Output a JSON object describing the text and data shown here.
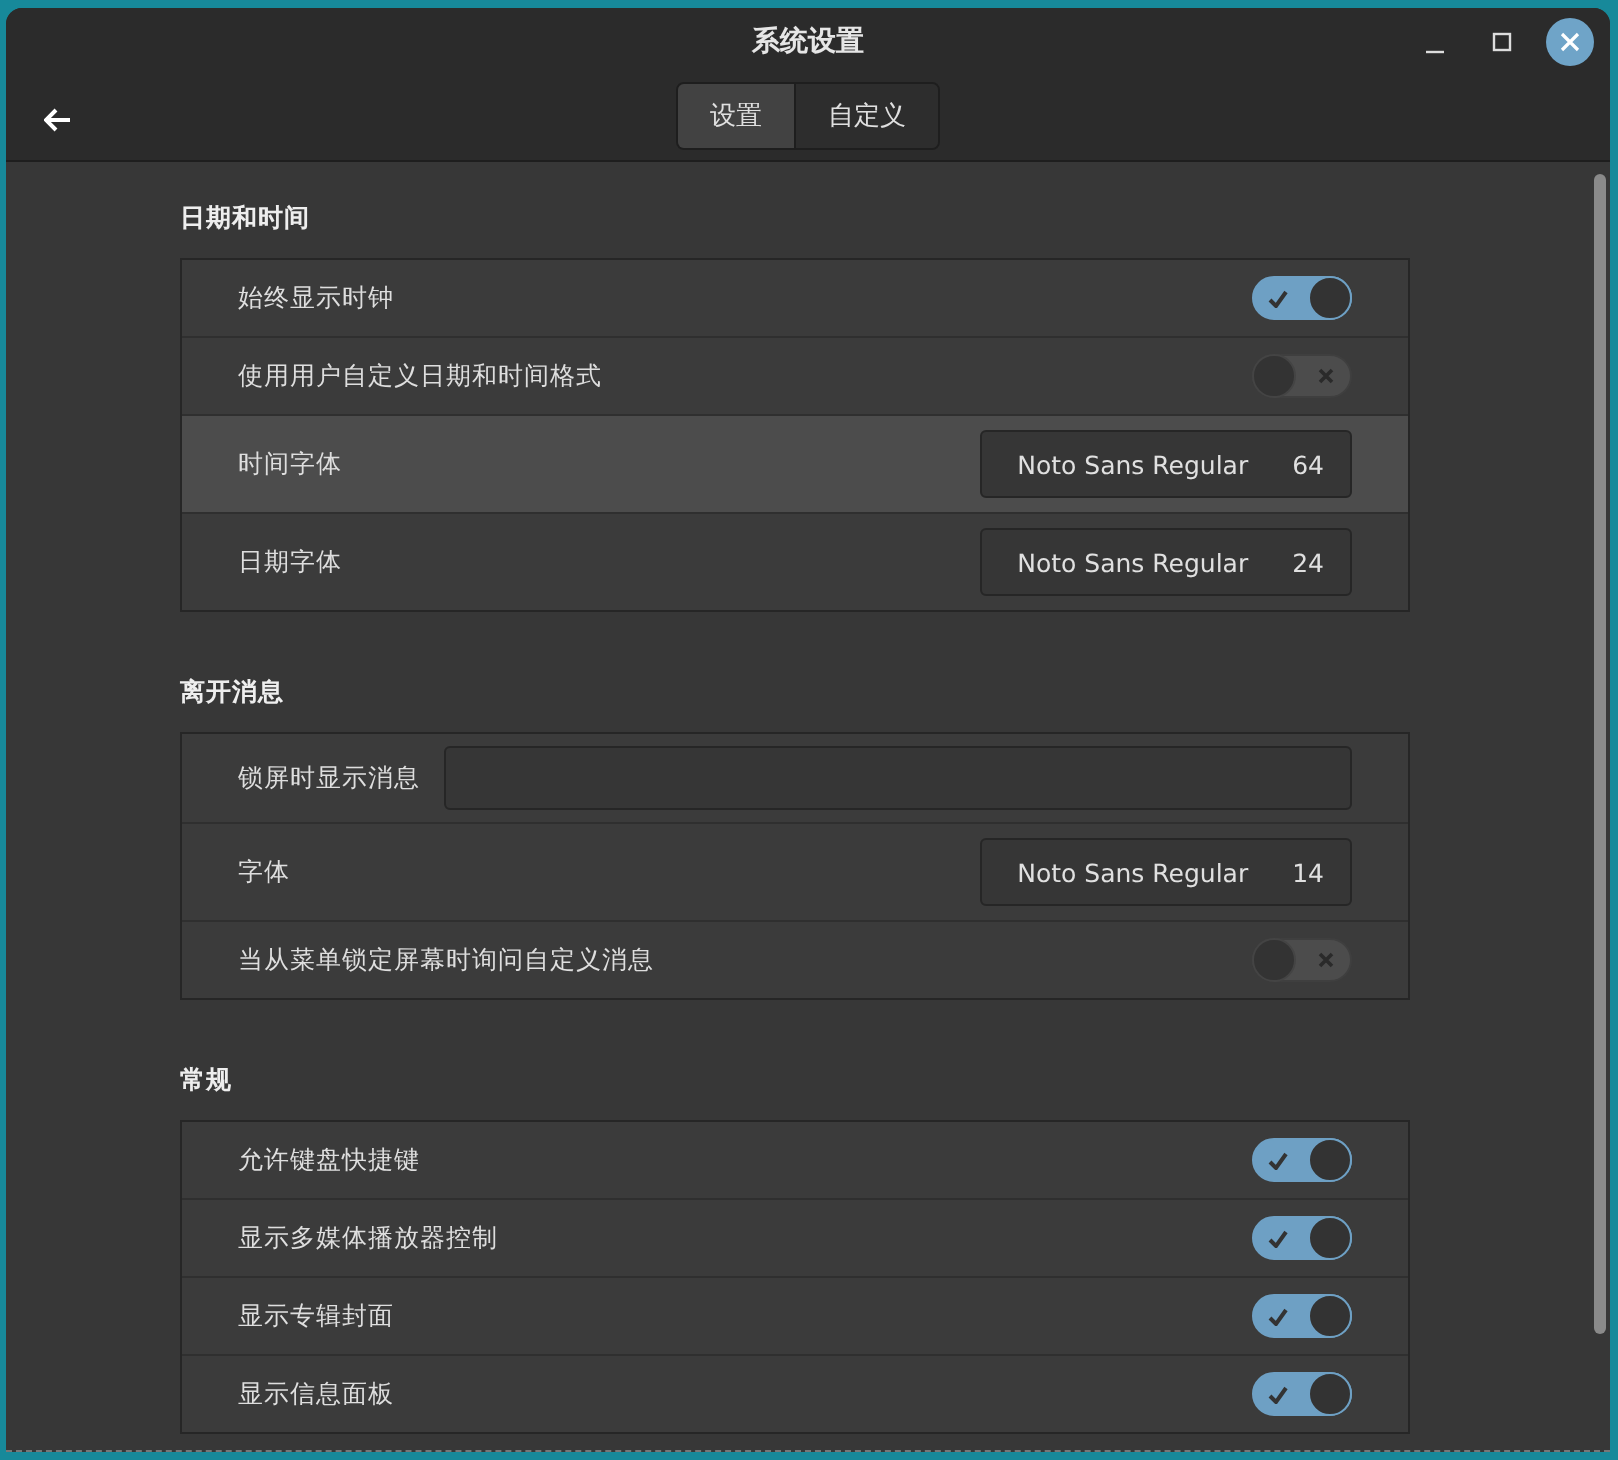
{
  "window": {
    "title": "系统设置"
  },
  "tabs": [
    {
      "label": "设置",
      "selected": true
    },
    {
      "label": "自定义",
      "selected": false
    }
  ],
  "sections": [
    {
      "heading": "日期和时间",
      "rows": [
        {
          "kind": "toggle",
          "label": "始终显示时钟",
          "on": true,
          "hovered": false
        },
        {
          "kind": "toggle",
          "label": "使用用户自定义日期和时间格式",
          "on": false,
          "hovered": false
        },
        {
          "kind": "font",
          "label": "时间字体",
          "font": "Noto Sans Regular",
          "size": "64",
          "hovered": true
        },
        {
          "kind": "font",
          "label": "日期字体",
          "font": "Noto Sans Regular",
          "size": "24",
          "hovered": false
        }
      ]
    },
    {
      "heading": "离开消息",
      "rows": [
        {
          "kind": "text",
          "label": "锁屏时显示消息",
          "hovered": false
        },
        {
          "kind": "font",
          "label": "字体",
          "font": "Noto Sans Regular",
          "size": "14",
          "hovered": false
        },
        {
          "kind": "toggle",
          "label": "当从菜单锁定屏幕时询问自定义消息",
          "on": false,
          "hovered": false
        }
      ]
    },
    {
      "heading": "常规",
      "rows": [
        {
          "kind": "toggle",
          "label": "允许键盘快捷键",
          "on": true,
          "hovered": false
        },
        {
          "kind": "toggle",
          "label": "显示多媒体播放器控制",
          "on": true,
          "hovered": false
        },
        {
          "kind": "toggle",
          "label": "显示专辑封面",
          "on": true,
          "hovered": false
        },
        {
          "kind": "toggle",
          "label": "显示信息面板",
          "on": true,
          "hovered": false
        }
      ]
    }
  ]
}
